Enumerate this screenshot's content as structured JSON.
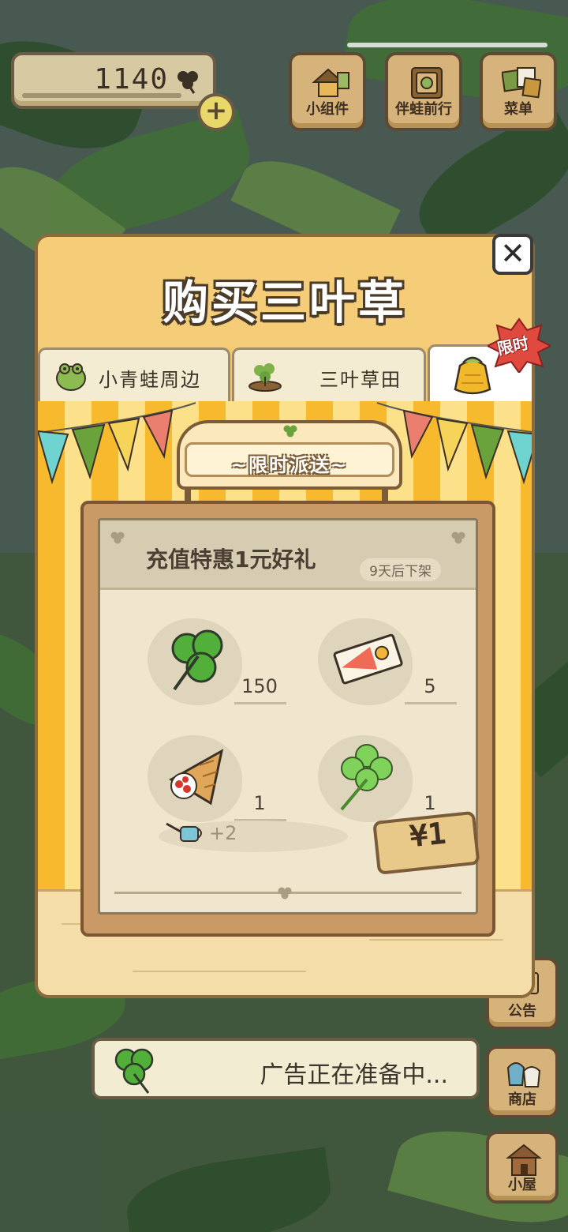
{
  "status": {
    "clover_count": "1140"
  },
  "top_menu": {
    "widgets_label": "小组件",
    "frog_travel_label": "伴蛙前行",
    "menu_label": "菜单"
  },
  "side_menu": {
    "notice_label": "公告",
    "shop_label": "商店",
    "house_label": "小屋"
  },
  "modal": {
    "title": "购买三叶草",
    "close_symbol": "✕",
    "tabs": [
      {
        "label": "小青蛙周边",
        "icon": "frog-icon"
      },
      {
        "label": "三叶草田",
        "icon": "sprout-icon"
      },
      {
        "label": "",
        "icon": "gift-bag-icon"
      }
    ],
    "limited_badge": "限时",
    "sign_text": "~限时派送~",
    "offer": {
      "name": "充值特惠1元好礼",
      "deadline": "9天后下架",
      "items": [
        {
          "icon": "clover-icon",
          "qty": "150"
        },
        {
          "icon": "ticket-icon",
          "qty": "5"
        },
        {
          "icon": "croissant-icon",
          "qty": "1"
        },
        {
          "icon": "four-leaf-clover-icon",
          "qty": "1"
        }
      ],
      "extra_icon": "watering-can-icon",
      "extra_text": "+2",
      "price": "¥1"
    }
  },
  "ad_bar": {
    "text": "广告正在准备中..."
  },
  "colors": {
    "stripe_orange": "#f7ba2f",
    "stripe_light": "#fde08a",
    "modal_bg": "#f3c86f",
    "wood": "#c99966",
    "leaf_green": "#4f8a3f"
  }
}
